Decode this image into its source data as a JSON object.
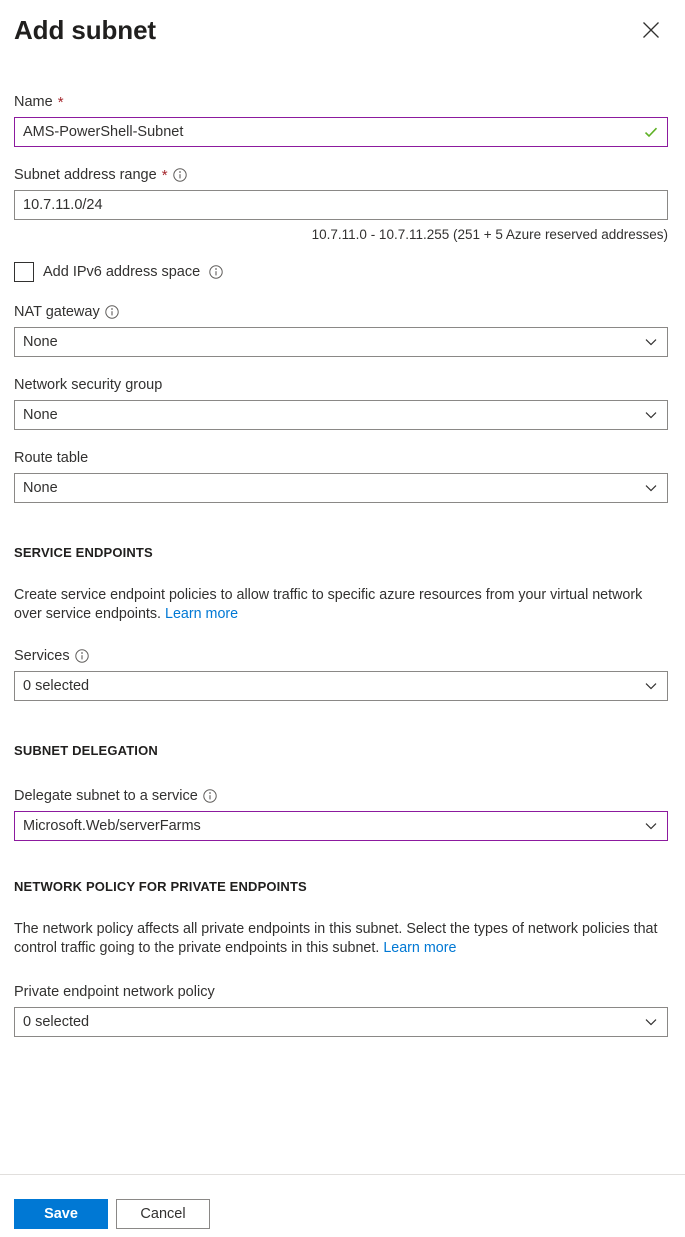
{
  "header": {
    "title": "Add subnet",
    "close_label": "Close"
  },
  "form": {
    "name": {
      "label": "Name",
      "required_marker": "*",
      "value": "AMS-PowerShell-Subnet",
      "valid": true
    },
    "address_range": {
      "label": "Subnet address range",
      "required_marker": "*",
      "value": "10.7.11.0/24",
      "helper": "10.7.11.0 - 10.7.11.255 (251 + 5 Azure reserved addresses)"
    },
    "ipv6": {
      "label": "Add IPv6 address space",
      "checked": false
    },
    "nat_gateway": {
      "label": "NAT gateway",
      "value": "None"
    },
    "network_security_group": {
      "label": "Network security group",
      "value": "None"
    },
    "route_table": {
      "label": "Route table",
      "value": "None"
    }
  },
  "service_endpoints": {
    "heading": "SERVICE ENDPOINTS",
    "description": "Create service endpoint policies to allow traffic to specific azure resources from your virtual network over service endpoints.",
    "learn_more": "Learn more",
    "services": {
      "label": "Services",
      "value": "0 selected"
    }
  },
  "subnet_delegation": {
    "heading": "SUBNET DELEGATION",
    "delegate": {
      "label": "Delegate subnet to a service",
      "value": "Microsoft.Web/serverFarms",
      "focused": true
    }
  },
  "network_policy": {
    "heading": "NETWORK POLICY FOR PRIVATE ENDPOINTS",
    "description": "The network policy affects all private endpoints in this subnet. Select the types of network policies that control traffic going to the private endpoints in this subnet.",
    "learn_more": "Learn more",
    "private_endpoint_policy": {
      "label": "Private endpoint network policy",
      "value": "0 selected"
    }
  },
  "footer": {
    "save_label": "Save",
    "cancel_label": "Cancel"
  },
  "colors": {
    "accent_blue": "#0078d4",
    "link_blue": "#0078d4",
    "focus_purple": "#8c1a9e",
    "required_red": "#a4262c",
    "valid_green": "#5eb125",
    "border_gray": "#8a8886"
  }
}
